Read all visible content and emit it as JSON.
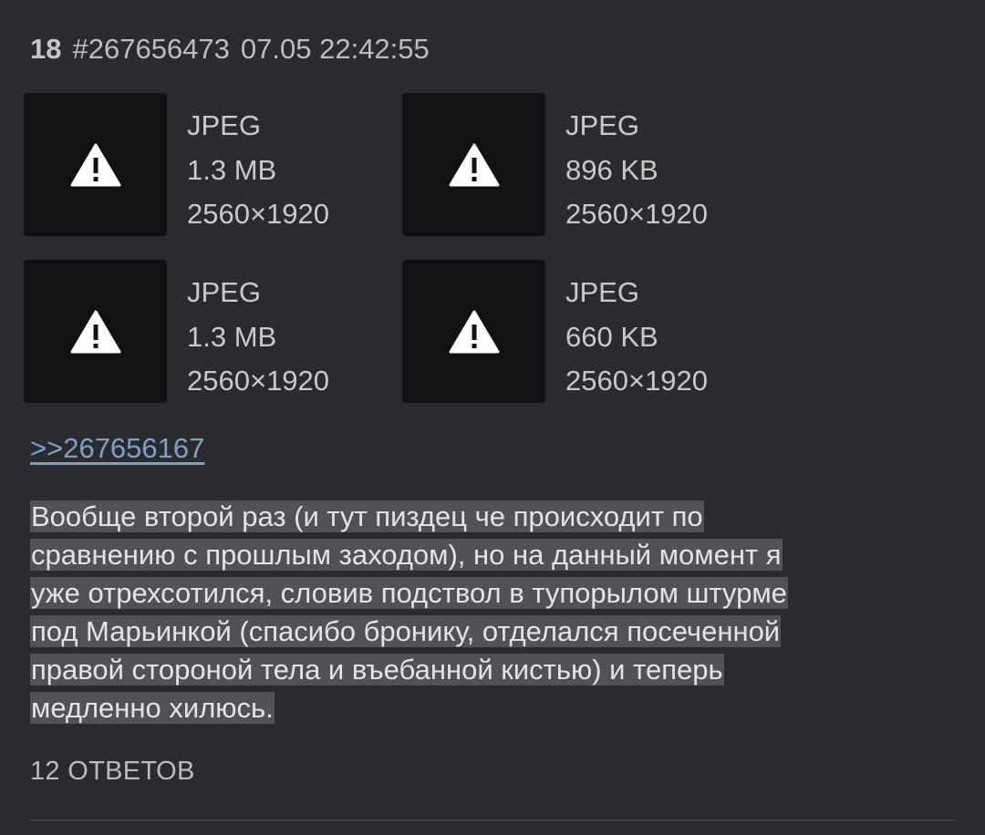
{
  "post": {
    "number": "18",
    "id": "#267656473",
    "timestamp": "07.05 22:42:55"
  },
  "attachments": [
    {
      "type": "JPEG",
      "size": "1.3 MB",
      "dimensions": "2560×1920",
      "icon": "warning-icon"
    },
    {
      "type": "JPEG",
      "size": "896 KB",
      "dimensions": "2560×1920",
      "icon": "warning-icon"
    },
    {
      "type": "JPEG",
      "size": "1.3 MB",
      "dimensions": "2560×1920",
      "icon": "warning-icon"
    },
    {
      "type": "JPEG",
      "size": "660 KB",
      "dimensions": "2560×1920",
      "icon": "warning-icon"
    }
  ],
  "reply_link": ">>267656167",
  "body_lines": [
    "Вообще второй раз (и тут пиздец че происходит по",
    "сравнению с прошлым заходом), но на данный момент я",
    "уже отрехсотился, словив подствол в тупорылом штурме",
    "под Марьинкой (спасибо бронику, отделался посеченной",
    "правой стороной тела и въебанной кистью) и теперь",
    "медленно хилюсь."
  ],
  "replies_label": "12 ОТВЕТОВ",
  "colors": {
    "background": "#2a2b2f",
    "thumbnail_bg": "#111111",
    "link": "#7f9fc4",
    "text_highlight": "#505257"
  }
}
